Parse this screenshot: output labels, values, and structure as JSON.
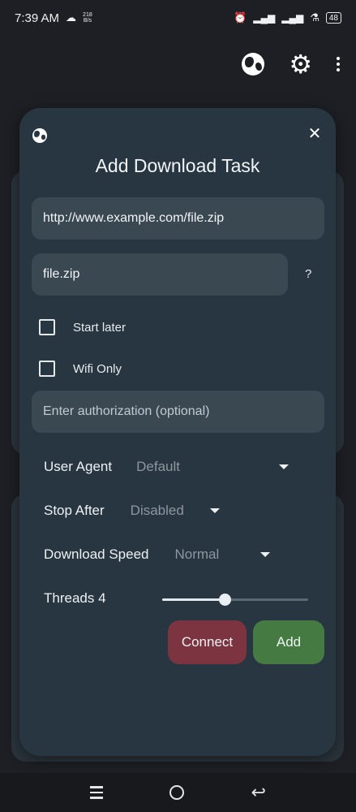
{
  "status_bar": {
    "time": "7:39 AM",
    "speed_value": "218",
    "speed_unit": "B/s",
    "battery": "48"
  },
  "app_bar": {
    "icons": [
      "globe-icon",
      "settings-gear-icon",
      "more-vert-icon"
    ]
  },
  "dialog": {
    "title": "Add Download Task",
    "url_value": "http://www.example.com/file.zip",
    "filename_value": "file.zip",
    "help_label": "?",
    "start_later_label": "Start later",
    "wifi_only_label": "Wifi Only",
    "auth_placeholder": "Enter authorization (optional)",
    "user_agent": {
      "label": "User Agent",
      "value": "Default"
    },
    "stop_after": {
      "label": "Stop After",
      "value": "Disabled"
    },
    "download_speed": {
      "label": "Download Speed",
      "value": "Normal"
    },
    "threads": {
      "label": "Threads 4",
      "level": 0.43
    },
    "connect_label": "Connect",
    "add_label": "Add"
  },
  "nav_bar": {
    "icons": [
      "recent-apps-icon",
      "home-icon",
      "back-icon"
    ]
  },
  "colors": {
    "dialog_bg": "#273641",
    "field_bg": "#3a4852",
    "connect_button": "#7b3440",
    "add_button": "#457b43"
  }
}
